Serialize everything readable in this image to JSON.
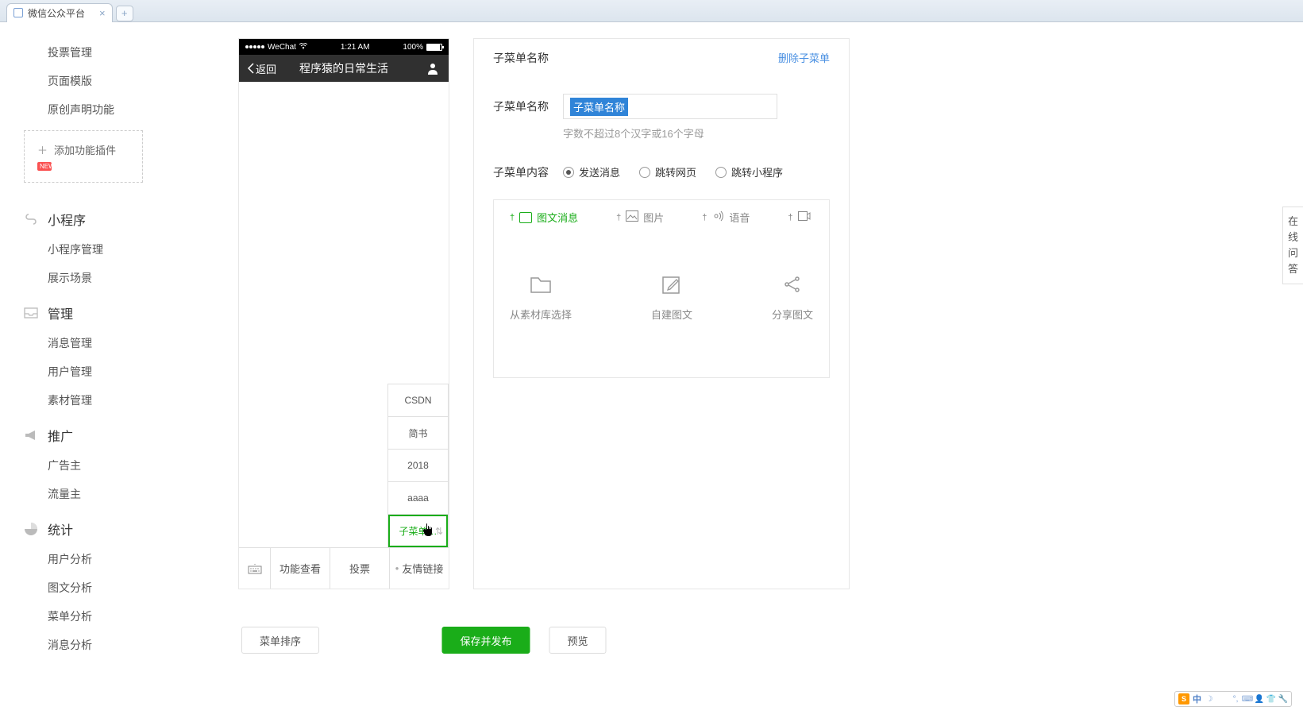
{
  "browser": {
    "tab_title": "微信公众平台",
    "close": "×",
    "add": "+"
  },
  "sidebar": {
    "items_top": [
      "投票管理",
      "页面模版",
      "原创声明功能"
    ],
    "add_plugin": "添加功能插件",
    "new_badge": "NEW",
    "sections": [
      {
        "title": "小程序",
        "items": [
          "小程序管理",
          "展示场景"
        ]
      },
      {
        "title": "管理",
        "items": [
          "消息管理",
          "用户管理",
          "素材管理"
        ]
      },
      {
        "title": "推广",
        "items": [
          "广告主",
          "流量主"
        ]
      },
      {
        "title": "统计",
        "items": [
          "用户分析",
          "图文分析",
          "菜单分析",
          "消息分析"
        ]
      }
    ]
  },
  "phone": {
    "carrier": "WeChat",
    "time": "1:21 AM",
    "battery": "100%",
    "back": "返回",
    "title": "程序猿的日常生活",
    "submenu_items": [
      "CSDN",
      "简书",
      "2018",
      "aaaa"
    ],
    "submenu_active": "子菜单…",
    "nav": [
      "功能查看",
      "投票",
      "友情链接"
    ]
  },
  "config": {
    "header_title": "子菜单名称",
    "delete": "删除子菜单",
    "name_label": "子菜单名称",
    "name_value": "子菜单名称",
    "name_hint": "字数不超过8个汉字或16个字母",
    "content_label": "子菜单内容",
    "radios": [
      "发送消息",
      "跳转网页",
      "跳转小程序"
    ],
    "content_tabs": [
      "图文消息",
      "图片",
      "语音"
    ],
    "content_tab_extra": "",
    "actions": [
      "从素材库选择",
      "自建图文",
      "分享图文"
    ]
  },
  "buttons": {
    "sort": "菜单排序",
    "save": "保存并发布",
    "preview": "预览"
  },
  "float_right": "在线问答",
  "ime": {
    "letter": "S",
    "lang": "中"
  }
}
